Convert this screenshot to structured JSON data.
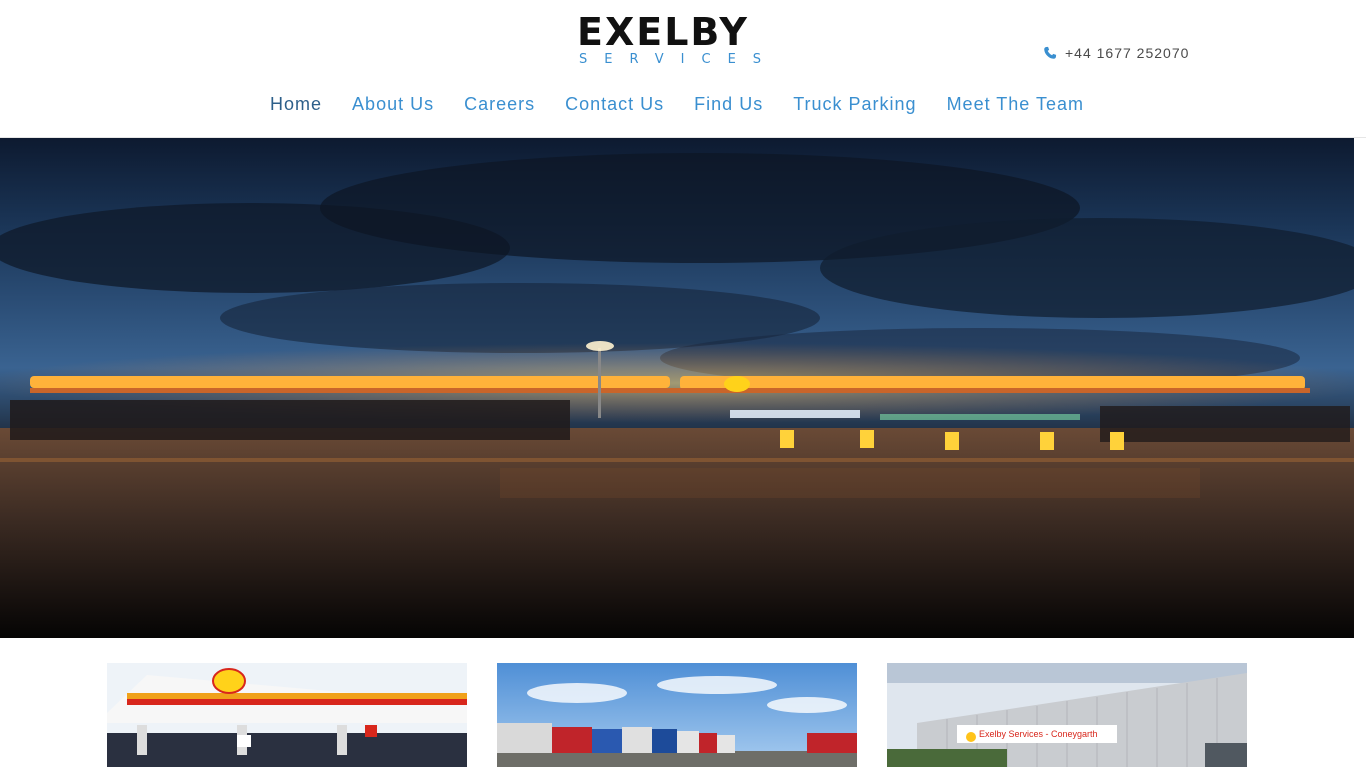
{
  "brand": {
    "logo_main": "EXELBY",
    "logo_sub": "SERVICES",
    "colors": {
      "accent": "#3a8fd0",
      "nav_active": "#2d5f8a",
      "text": "#111111"
    }
  },
  "header": {
    "phone": "+44 1677 252070",
    "phone_icon": "phone-icon"
  },
  "nav": {
    "items": [
      {
        "label": "Home",
        "active": true
      },
      {
        "label": "About Us"
      },
      {
        "label": "Careers"
      },
      {
        "label": "Contact Us"
      },
      {
        "label": "Find Us"
      },
      {
        "label": "Truck Parking"
      },
      {
        "label": "Meet The Team"
      }
    ]
  },
  "cards": {
    "card3_sign": "Exelby Services - Coneygarth"
  }
}
